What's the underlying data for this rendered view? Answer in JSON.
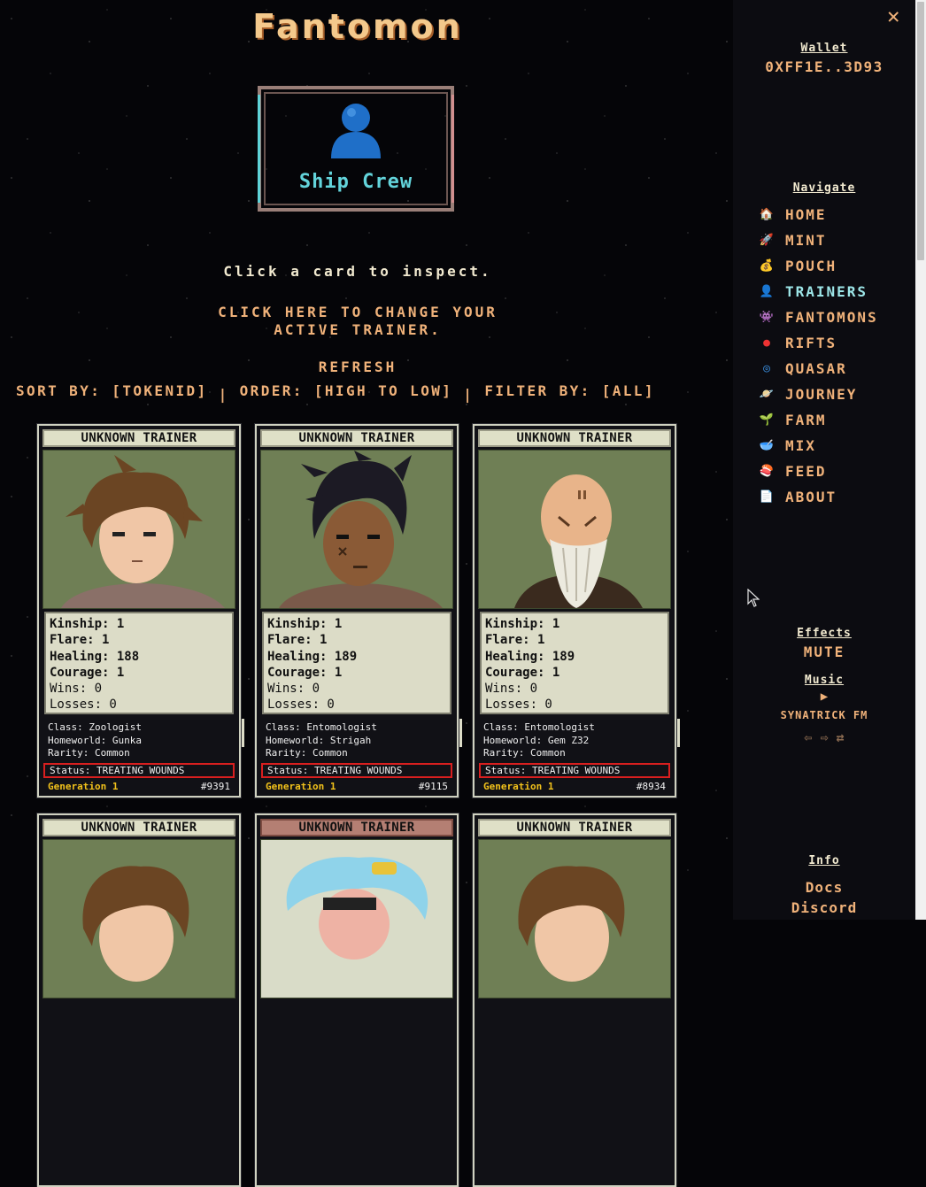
{
  "app": {
    "title": "Fantomon"
  },
  "crew_button": {
    "label": "Ship Crew",
    "icon": "person-icon"
  },
  "instructions": "Click a card to inspect.",
  "change_trainer": {
    "line1": "CLICK HERE TO CHANGE YOUR",
    "line2": "ACTIVE TRAINER."
  },
  "refresh_label": "REFRESH",
  "controls": {
    "sort": "SORT BY: [TOKENID]",
    "order": "ORDER: [HIGH TO LOW]",
    "filter": "FILTER BY: [ALL]",
    "separator": "|"
  },
  "cards": [
    {
      "name": "UNKNOWN TRAINER",
      "kinship": "Kinship: 1",
      "flare": "Flare: 1",
      "healing": "Healing: 188",
      "courage": "Courage: 1",
      "wins": "Wins: 0",
      "losses": "Losses: 0",
      "class": "Class: Zoologist",
      "homeworld": "Homeworld: Gunka",
      "rarity": "Rarity: Common",
      "status": "Status: TREATING WOUNDS",
      "generation": "Generation 1",
      "token": "#9391"
    },
    {
      "name": "UNKNOWN TRAINER",
      "kinship": "Kinship: 1",
      "flare": "Flare: 1",
      "healing": "Healing: 189",
      "courage": "Courage: 1",
      "wins": "Wins: 0",
      "losses": "Losses: 0",
      "class": "Class: Entomologist",
      "homeworld": "Homeworld: Strigah",
      "rarity": "Rarity: Common",
      "status": "Status: TREATING WOUNDS",
      "generation": "Generation 1",
      "token": "#9115"
    },
    {
      "name": "UNKNOWN TRAINER",
      "kinship": "Kinship: 1",
      "flare": "Flare: 1",
      "healing": "Healing: 189",
      "courage": "Courage: 1",
      "wins": "Wins: 0",
      "losses": "Losses: 0",
      "class": "Class: Entomologist",
      "homeworld": "Homeworld: Gem Z32",
      "rarity": "Rarity: Common",
      "status": "Status: TREATING WOUNDS",
      "generation": "Generation 1",
      "token": "#8934"
    },
    {
      "name": "UNKNOWN TRAINER"
    },
    {
      "name": "UNKNOWN TRAINER"
    },
    {
      "name": "UNKNOWN TRAINER"
    }
  ],
  "sidebar": {
    "close_icon": "close-icon",
    "wallet_heading": "Wallet",
    "wallet_address": "0XFF1E..3D93",
    "navigate_heading": "Navigate",
    "nav": [
      {
        "label": "HOME",
        "icon": "house-icon"
      },
      {
        "label": "MINT",
        "icon": "rocket-icon"
      },
      {
        "label": "POUCH",
        "icon": "money-bag-icon"
      },
      {
        "label": "TRAINERS",
        "icon": "person-icon",
        "active": true
      },
      {
        "label": "FANTOMONS",
        "icon": "alien-monster-icon"
      },
      {
        "label": "RIFTS",
        "icon": "drop-icon"
      },
      {
        "label": "QUASAR",
        "icon": "vortex-icon"
      },
      {
        "label": "JOURNEY",
        "icon": "planet-icon"
      },
      {
        "label": "FARM",
        "icon": "seedling-icon"
      },
      {
        "label": "MIX",
        "icon": "mixing-bowl-icon"
      },
      {
        "label": "FEED",
        "icon": "food-icon"
      },
      {
        "label": "ABOUT",
        "icon": "page-icon"
      }
    ],
    "effects_heading": "Effects",
    "effects_value": "MUTE",
    "music_heading": "Music",
    "music_play": "▶",
    "music_station": "SYNATRICK FM",
    "music_prev": "⇦",
    "music_next": "⇨",
    "music_shuffle": "⇄",
    "info_heading": "Info",
    "info_links": [
      "Docs",
      "Discord"
    ]
  },
  "colors": {
    "accent": "#f0b27a",
    "active": "#9de6e8",
    "status_border": "#d81f1f",
    "generation": "#f2c21b"
  }
}
